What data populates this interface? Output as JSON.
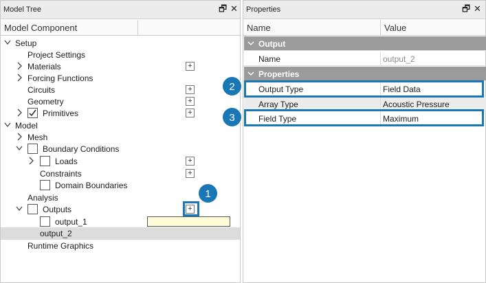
{
  "model_tree": {
    "title": "Model Tree",
    "column_header": "Model Component",
    "items": [
      {
        "label": "Setup"
      },
      {
        "label": "Project Settings"
      },
      {
        "label": "Materials"
      },
      {
        "label": "Forcing Functions"
      },
      {
        "label": "Circuits"
      },
      {
        "label": "Geometry"
      },
      {
        "label": "Primitives"
      },
      {
        "label": "Model"
      },
      {
        "label": "Mesh"
      },
      {
        "label": "Boundary Conditions"
      },
      {
        "label": "Loads"
      },
      {
        "label": "Constraints"
      },
      {
        "label": "Domain Boundaries"
      },
      {
        "label": "Analysis"
      },
      {
        "label": "Outputs"
      },
      {
        "label": "output_1"
      },
      {
        "label": "output_2"
      },
      {
        "label": "Runtime Graphics"
      }
    ],
    "plus_symbol": "+",
    "restore_symbol": "🗗",
    "close_symbol": "✕"
  },
  "properties": {
    "title": "Properties",
    "col_name": "Name",
    "col_value": "Value",
    "sections": [
      {
        "label": "Output"
      },
      {
        "label": "Properties"
      }
    ],
    "rows": [
      {
        "name": "Name",
        "value": "output_2"
      },
      {
        "name": "Output Type",
        "value": "Field Data"
      },
      {
        "name": "Array Type",
        "value": "Acoustic Pressure"
      },
      {
        "name": "Field Type",
        "value": "Maximum"
      }
    ]
  },
  "callouts": [
    "1",
    "2",
    "3"
  ],
  "colors": {
    "accent": "#1a77b6",
    "category_row": "#9b9b9b",
    "selected_row": "#dcdcdc",
    "edit_field": "#fffbd9"
  }
}
